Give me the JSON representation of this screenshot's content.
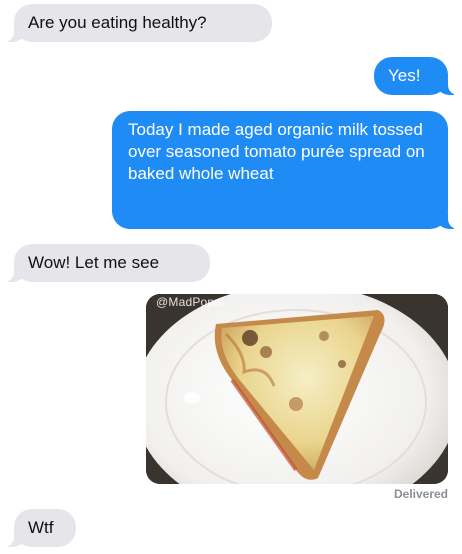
{
  "messages": [
    {
      "direction": "incoming",
      "text": "Are you eating healthy?"
    },
    {
      "direction": "outgoing",
      "text": "Yes!"
    },
    {
      "direction": "outgoing",
      "text": "Today I made aged organic milk tossed over seasoned tomato purée spread on baked whole wheat"
    },
    {
      "direction": "incoming",
      "text": "Wow! Let me see"
    },
    {
      "direction": "outgoing",
      "type": "image",
      "watermark": "@MadPopal"
    },
    {
      "direction": "incoming",
      "text": "Wtf"
    }
  ],
  "status": {
    "delivered_label": "Delivered"
  },
  "colors": {
    "outgoing_bubble": "#1f8cf5",
    "incoming_bubble": "#e5e5ea",
    "status_text": "#8e8e93"
  }
}
